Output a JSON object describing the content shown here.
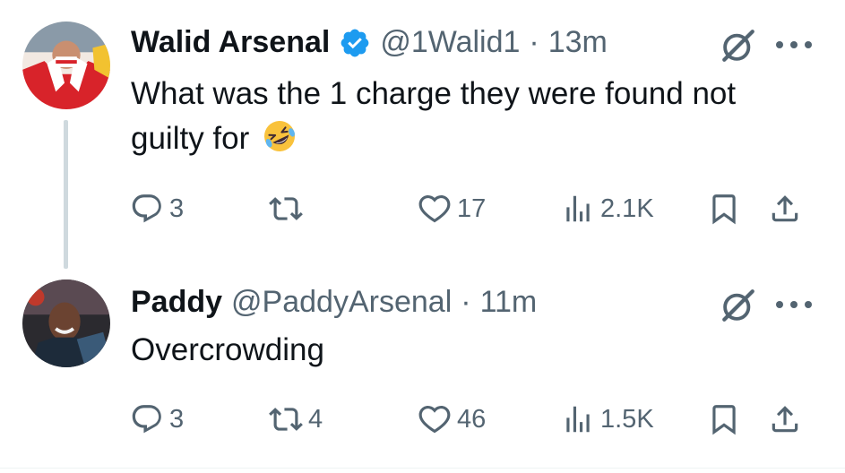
{
  "tweets": [
    {
      "author_name": "Walid Arsenal",
      "verified": true,
      "handle": "@1Walid1",
      "separator": "·",
      "time": "13m",
      "text": "What was the 1 charge they were found not guilty for",
      "emoji": "rolling-on-the-floor-laughing",
      "replies": "3",
      "reposts": "",
      "likes": "17",
      "views": "2.1K"
    },
    {
      "author_name": "Paddy",
      "verified": false,
      "handle": "@PaddyArsenal",
      "separator": "·",
      "time": "11m",
      "text": "Overcrowding",
      "replies": "3",
      "reposts": "4",
      "likes": "46",
      "views": "1.5K"
    }
  ],
  "icons": {
    "reply": "reply-icon",
    "repost": "repost-icon",
    "like": "heart-icon",
    "views": "views-icon",
    "bookmark": "bookmark-icon",
    "share": "share-icon",
    "grok": "grok-icon",
    "more": "more-icon",
    "verified": "verified-badge-icon"
  },
  "colors": {
    "text_primary": "#0f1419",
    "text_secondary": "#536471",
    "verified_blue": "#1d9bf0",
    "thread_line": "#cfd9de"
  }
}
